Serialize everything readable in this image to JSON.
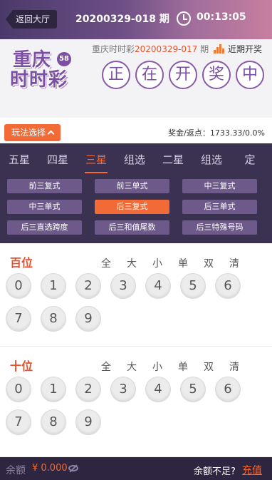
{
  "header": {
    "back_label": "返回大厅",
    "period_title": "20200329-018 期",
    "countdown": "00:13:05"
  },
  "lottery": {
    "logo_line1": "重庆",
    "logo_line2": "时时彩",
    "logo_badge": "58",
    "prev_name": "重庆时时彩",
    "prev_period": "20200329-017",
    "prev_suffix": " 期",
    "recent_link": "近期开奖",
    "status_chars": [
      "正",
      "在",
      "开",
      "奖",
      "中"
    ]
  },
  "play": {
    "select_label": "玩法选择",
    "bonus": "奖金/返点：1733.33/0.0%"
  },
  "tabs": [
    "五星",
    "四星",
    "三星",
    "组选",
    "二星",
    "组选",
    "定"
  ],
  "active_tab": 2,
  "subtypes": [
    "前三复式",
    "前三单式",
    "中三复式",
    "中三单式",
    "后三复式",
    "后三单式",
    "后三直选跨度",
    "后三和值尾数",
    "后三特殊号码"
  ],
  "active_subtype": 4,
  "sections": [
    {
      "title": "百位",
      "quick": [
        "全",
        "大",
        "小",
        "单",
        "双",
        "清"
      ],
      "numbers": [
        "0",
        "1",
        "2",
        "3",
        "4",
        "5",
        "6",
        "7",
        "8",
        "9"
      ]
    },
    {
      "title": "十位",
      "quick": [
        "全",
        "大",
        "小",
        "单",
        "双",
        "清"
      ],
      "numbers": [
        "0",
        "1",
        "2",
        "3",
        "4",
        "5",
        "6",
        "7",
        "8",
        "9"
      ]
    }
  ],
  "footer": {
    "balance_label": "余额",
    "balance_value": "¥ 0.000",
    "insufficient": "余额不足?",
    "recharge": "充值"
  },
  "colors": {
    "accent": "#f26a35",
    "panel": "#3a3250",
    "brand": "#7b4fa3"
  }
}
